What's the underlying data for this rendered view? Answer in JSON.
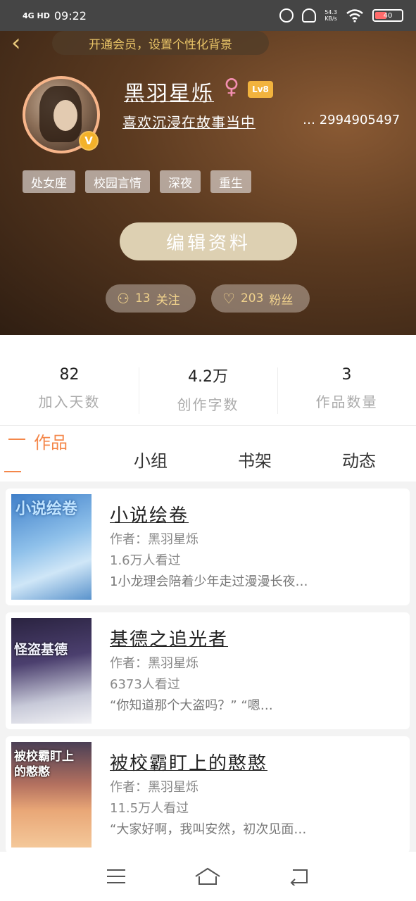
{
  "status_bar": {
    "network": "4G HD",
    "time": "09:22",
    "speed": "54.3\nKB/s",
    "battery_percent": 40,
    "battery_label": "40"
  },
  "header": {
    "vip_banner": "开通会员，设置个性化背景",
    "nickname": "黑羽星烁",
    "gender_symbol": "♀",
    "level": "Lv8",
    "signature": "喜欢沉浸在故事当中",
    "uid": "… 2994905497",
    "tags": [
      "处女座",
      "校园言情",
      "深夜",
      "重生"
    ],
    "edit_button": "编辑资料",
    "following": {
      "count": "13",
      "label": "关注"
    },
    "followers": {
      "count": "203",
      "label": "粉丝"
    }
  },
  "stats": [
    {
      "value": "82",
      "label": "加入天数"
    },
    {
      "value": "4.2万",
      "label": "创作字数"
    },
    {
      "value": "3",
      "label": "作品数量"
    }
  ],
  "tabs": [
    {
      "label": "作品",
      "active": true
    },
    {
      "label": "小组",
      "active": false
    },
    {
      "label": "书架",
      "active": false
    },
    {
      "label": "动态",
      "active": false
    }
  ],
  "works": [
    {
      "title": "小说绘卷",
      "author": "作者：黑羽星烁",
      "reads": "1.6万人看过",
      "desc": "1小龙理会陪着少年走过漫漫长夜…",
      "cover_text": "小说绘卷"
    },
    {
      "title": "基德之追光者",
      "author": "作者：黑羽星烁",
      "reads": "6373人看过",
      "desc": "“你知道那个大盗吗？” “嗯…",
      "cover_text": "怪盗基德"
    },
    {
      "title": "被校霸盯上的憨憨",
      "author": "作者：黑羽星烁",
      "reads": "11.5万人看过",
      "desc": "“大家好啊，我叫安然，初次见面…",
      "cover_text": "被校霸盯上的憨憨"
    }
  ],
  "colors": {
    "accent": "#f4874a",
    "gold": "#e9c467",
    "level_badge": "#f2b33d",
    "edit_button": "#ddd0b2"
  }
}
